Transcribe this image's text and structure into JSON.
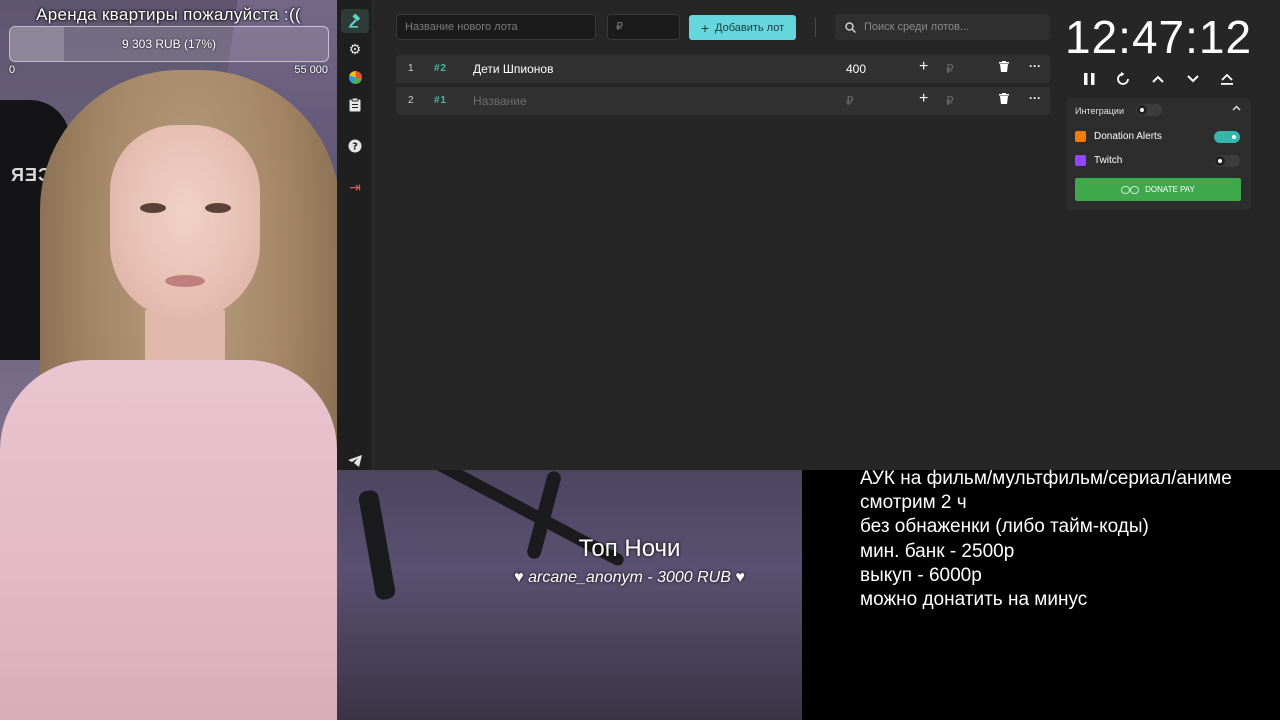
{
  "goal": {
    "title": "Аренда квартиры пожалуйста :((",
    "progress_text": "9 303 RUB (17%)",
    "progress_fraction": 0.17,
    "min_label": "0",
    "max_label": "55 000"
  },
  "sidebar": {
    "items": [
      {
        "name": "auction-gavel",
        "icon": "gavel"
      },
      {
        "name": "settings",
        "icon": "gear"
      },
      {
        "name": "stats",
        "icon": "pie-chart"
      },
      {
        "name": "history",
        "icon": "clipboard"
      },
      {
        "name": "help",
        "icon": "question"
      },
      {
        "name": "logout",
        "icon": "logout"
      },
      {
        "name": "telegram",
        "icon": "paper-plane"
      }
    ]
  },
  "toolbar": {
    "new_lot_placeholder": "Название нового лота",
    "amount_placeholder": "₽",
    "add_button_label": "Добавить лот",
    "search_placeholder": "Поиск среди лотов..."
  },
  "lots": [
    {
      "index": "1",
      "id": "2",
      "name": "Дети Шпионов",
      "amount": "400",
      "rub": "₽"
    },
    {
      "index": "2",
      "id": "1",
      "name": "Название",
      "amount": "₽",
      "rub": "₽"
    }
  ],
  "timer": {
    "value": "12:47:12",
    "controls": [
      "pause-icon",
      "restart-icon",
      "chevron-up-icon",
      "chevron-down-icon",
      "eject-icon"
    ]
  },
  "integrations": {
    "title": "Интеграции",
    "enabled": false,
    "items": [
      {
        "label": "Donation Alerts",
        "enabled": true,
        "color": "#f57d07"
      },
      {
        "label": "Twitch",
        "enabled": false,
        "color": "#9146ff"
      }
    ],
    "donate_button_label": "DONATE PAY",
    "donate_color": "#3fa84a"
  },
  "overlay": {
    "top_night_title": "Топ Ночи",
    "top_donor": "♥ arcane_anonym - 3000 RUB ♥"
  },
  "rules": {
    "lines": [
      "АУК на фильм/мультфильм/сериал/аниме",
      "смотрим 2 ч",
      "без обнаженки (либо тайм-коды)",
      "мин. банк - 2500р",
      "выкуп - 6000р",
      "можно донатить на минус"
    ]
  },
  "colors": {
    "accent": "#65d6dc",
    "app_bg": "#262626",
    "row_bg": "#313131",
    "lot_id": "#46b6a6"
  }
}
